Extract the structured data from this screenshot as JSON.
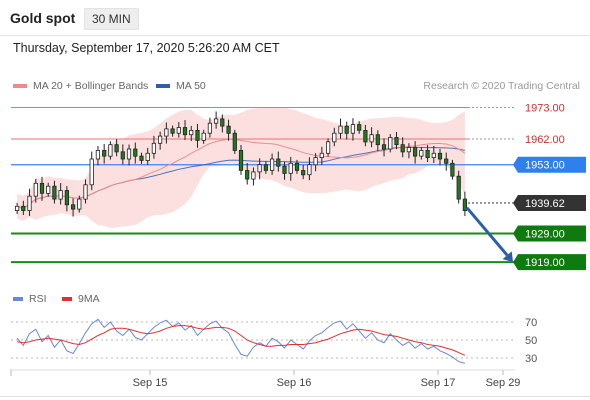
{
  "header": {
    "title": "Gold spot",
    "timeframe": "30 MIN"
  },
  "datetime": "Thursday, September 17, 2020 5:26:20 AM CET",
  "legend": {
    "items": [
      {
        "label": "MA 20 + Bollinger Bands",
        "color": "#f08a8a"
      },
      {
        "label": "MA 50",
        "color": "#2e5ea8"
      }
    ],
    "credit": "Research © 2020 Trading Central"
  },
  "rsi_legend": {
    "items": [
      {
        "label": "RSI",
        "color": "#6a88d8"
      },
      {
        "label": "9MA",
        "color": "#e03030"
      }
    ]
  },
  "chart_data": {
    "type": "candlestick",
    "instrument": "Gold spot",
    "interval": "30 MIN",
    "price_axis": {
      "range": [
        1911,
        1977
      ]
    },
    "levels": [
      {
        "value": 1973.0,
        "label": "1973.00",
        "kind": "resistance",
        "color": "#e57373"
      },
      {
        "value": 1962.0,
        "label": "1962.00",
        "kind": "resistance",
        "color": "#e57373"
      },
      {
        "value": 1953.0,
        "label": "1953.00",
        "kind": "pivot",
        "color": "#3b82f6"
      },
      {
        "value": 1939.62,
        "label": "1939.62",
        "kind": "last-price",
        "color": "#333333"
      },
      {
        "value": 1929.0,
        "label": "1929.00",
        "kind": "support",
        "color": "#1a8a1a"
      },
      {
        "value": 1919.0,
        "label": "1919.00",
        "kind": "support",
        "color": "#1a8a1a"
      }
    ],
    "x_labels": [
      "Sep 15",
      "Sep 16",
      "Sep 17",
      "Sep 29"
    ],
    "closes": [
      1938.5,
      1937.0,
      1942.0,
      1946.5,
      1943.0,
      1945.5,
      1941.0,
      1944.0,
      1939.0,
      1937.5,
      1941.0,
      1946.0,
      1955.0,
      1958.0,
      1956.0,
      1960.0,
      1957.5,
      1955.0,
      1958.5,
      1956.0,
      1954.5,
      1957.0,
      1960.5,
      1963.0,
      1965.5,
      1964.0,
      1966.0,
      1963.5,
      1965.0,
      1961.5,
      1964.0,
      1967.5,
      1969.0,
      1966.5,
      1964.0,
      1958.0,
      1951.0,
      1948.0,
      1950.5,
      1953.0,
      1951.0,
      1955.0,
      1952.5,
      1950.0,
      1953.5,
      1951.0,
      1949.5,
      1953.0,
      1955.5,
      1957.0,
      1961.0,
      1964.0,
      1966.5,
      1964.0,
      1967.0,
      1965.0,
      1961.0,
      1963.5,
      1960.0,
      1958.5,
      1962.5,
      1960.0,
      1957.5,
      1959.0,
      1956.0,
      1958.0,
      1955.5,
      1957.0,
      1955.0,
      1953.5,
      1949.0,
      1941.0,
      1937.0
    ],
    "direction": "down",
    "projection": {
      "from": 1938.0,
      "to": 1919.0,
      "color": "#2e5ea8"
    },
    "rsi": {
      "levels": [
        70,
        50,
        30
      ],
      "range": [
        20,
        80
      ],
      "rsi_values": [
        52,
        44,
        57,
        62,
        48,
        55,
        42,
        50,
        38,
        35,
        46,
        58,
        68,
        73,
        64,
        70,
        60,
        55,
        62,
        53,
        50,
        57,
        64,
        69,
        72,
        65,
        69,
        61,
        66,
        55,
        62,
        68,
        71,
        63,
        58,
        45,
        34,
        32,
        42,
        47,
        43,
        52,
        48,
        41,
        50,
        45,
        40,
        49,
        55,
        58,
        64,
        69,
        71,
        62,
        68,
        60,
        52,
        58,
        50,
        47,
        57,
        50,
        44,
        48,
        41,
        46,
        40,
        43,
        38,
        35,
        31,
        26,
        24
      ],
      "ma_values": [
        48,
        47,
        48,
        50,
        51,
        52,
        51,
        50,
        48,
        46,
        45,
        47,
        51,
        55,
        58,
        62,
        63,
        63,
        62,
        60,
        58,
        57,
        58,
        60,
        63,
        65,
        66,
        66,
        65,
        63,
        62,
        63,
        64,
        64,
        63,
        60,
        55,
        50,
        47,
        45,
        43,
        43,
        44,
        44,
        45,
        45,
        45,
        46,
        47,
        49,
        51,
        54,
        57,
        59,
        61,
        62,
        61,
        60,
        58,
        56,
        55,
        54,
        52,
        50,
        48,
        47,
        45,
        44,
        43,
        41,
        39,
        36,
        33
      ]
    }
  }
}
